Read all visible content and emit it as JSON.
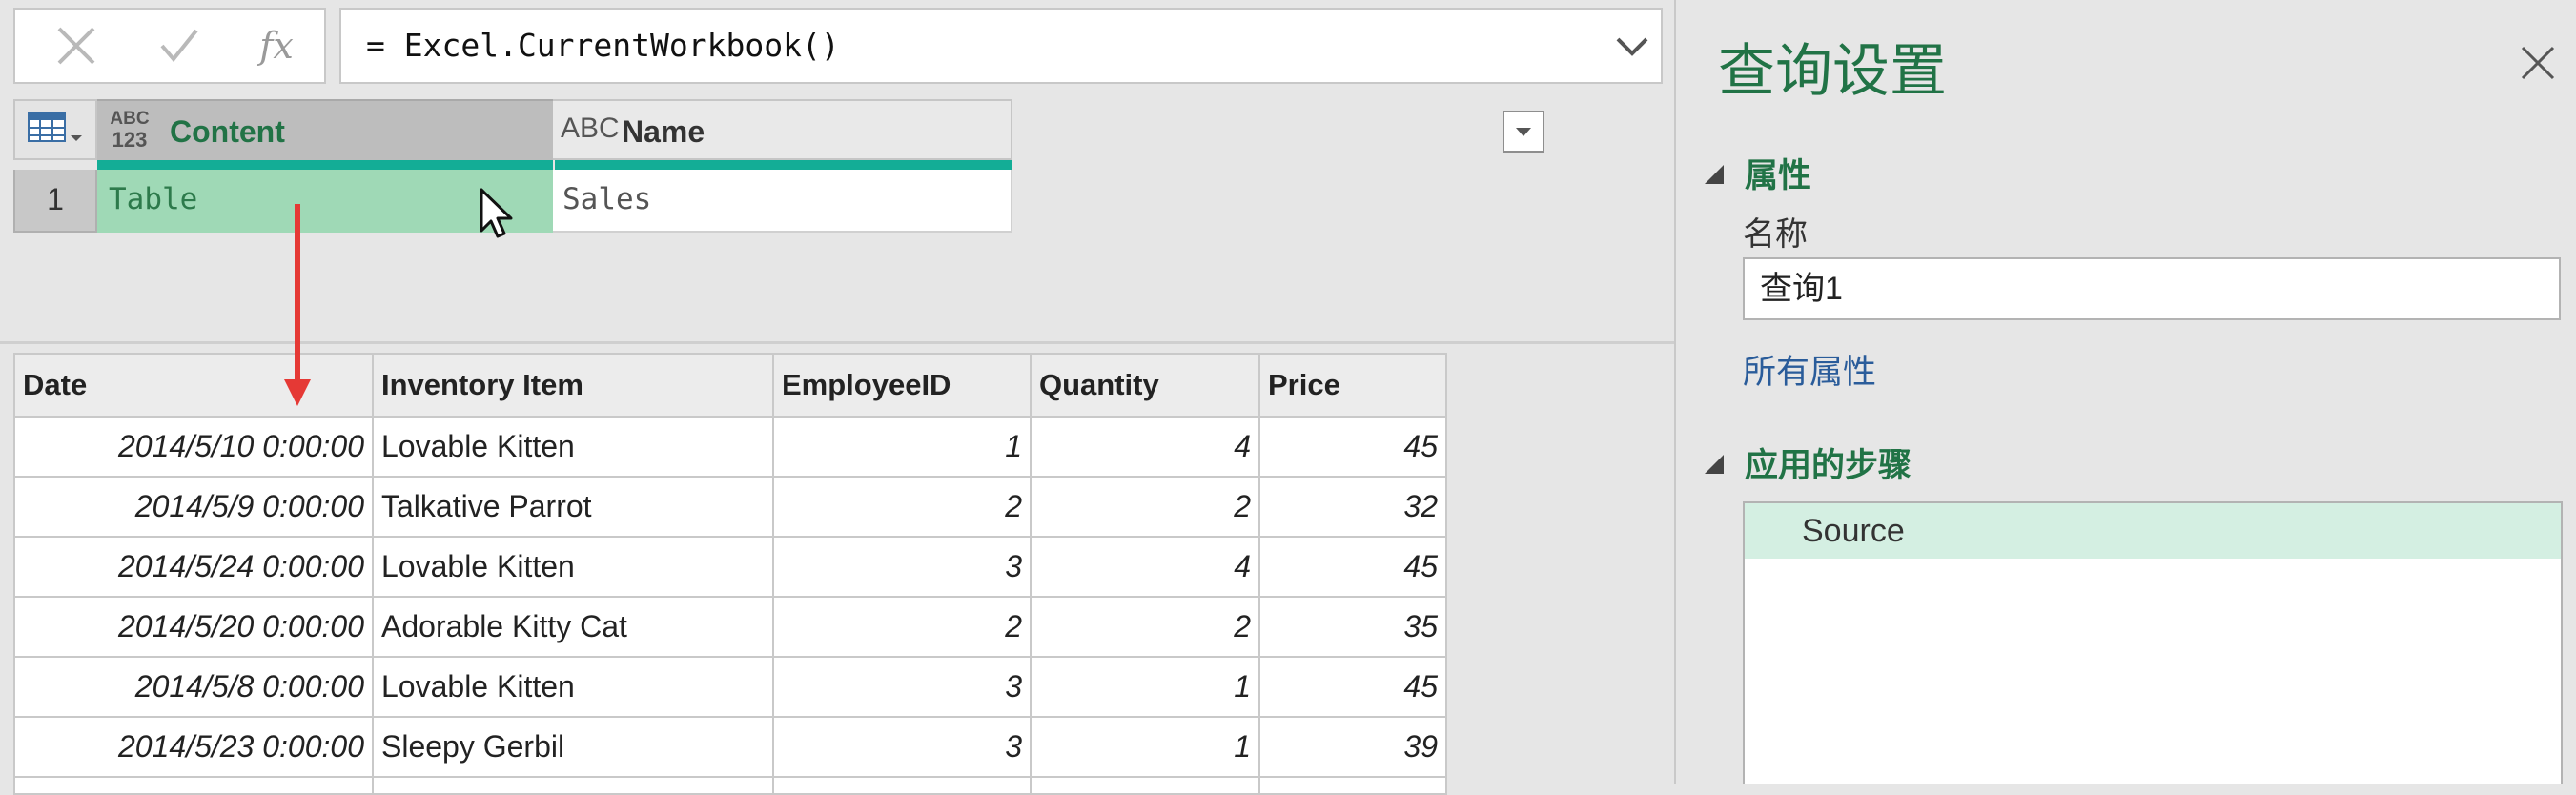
{
  "formula_bar": {
    "cancel_icon": "close-x-icon",
    "commit_icon": "checkmark-icon",
    "fx_label": "fx",
    "formula": "= Excel.CurrentWorkbook()",
    "expand_icon": "chevron-down-icon"
  },
  "result_grid": {
    "columns": [
      {
        "type_label_top": "ABC",
        "type_label_bottom": "123",
        "name": "Content"
      },
      {
        "type_label": "ABC",
        "name": "Name"
      }
    ],
    "rows": [
      {
        "row_number": "1",
        "content": "Table",
        "name": "Sales"
      }
    ]
  },
  "preview_table": {
    "columns": [
      "Date",
      "Inventory Item",
      "EmployeeID",
      "Quantity",
      "Price"
    ],
    "rows": [
      [
        "2014/5/10 0:00:00",
        "Lovable Kitten",
        "1",
        "4",
        "45"
      ],
      [
        "2014/5/9 0:00:00",
        "Talkative Parrot",
        "2",
        "2",
        "32"
      ],
      [
        "2014/5/24 0:00:00",
        "Lovable Kitten",
        "3",
        "4",
        "45"
      ],
      [
        "2014/5/20 0:00:00",
        "Adorable Kitty Cat",
        "2",
        "2",
        "35"
      ],
      [
        "2014/5/8 0:00:00",
        "Lovable Kitten",
        "3",
        "1",
        "45"
      ],
      [
        "2014/5/23 0:00:00",
        "Sleepy Gerbil",
        "3",
        "1",
        "39"
      ]
    ]
  },
  "query_settings": {
    "title": "查询设置",
    "properties_header": "属性",
    "name_label": "名称",
    "name_value": "查询1",
    "all_properties_link": "所有属性",
    "applied_steps_header": "应用的步骤",
    "steps": [
      "Source"
    ]
  },
  "colors": {
    "accent_green": "#217346",
    "selected_cell": "#9fd9b6",
    "column_quality_bar": "#13ad96",
    "arrow_annotation": "#e53935"
  }
}
